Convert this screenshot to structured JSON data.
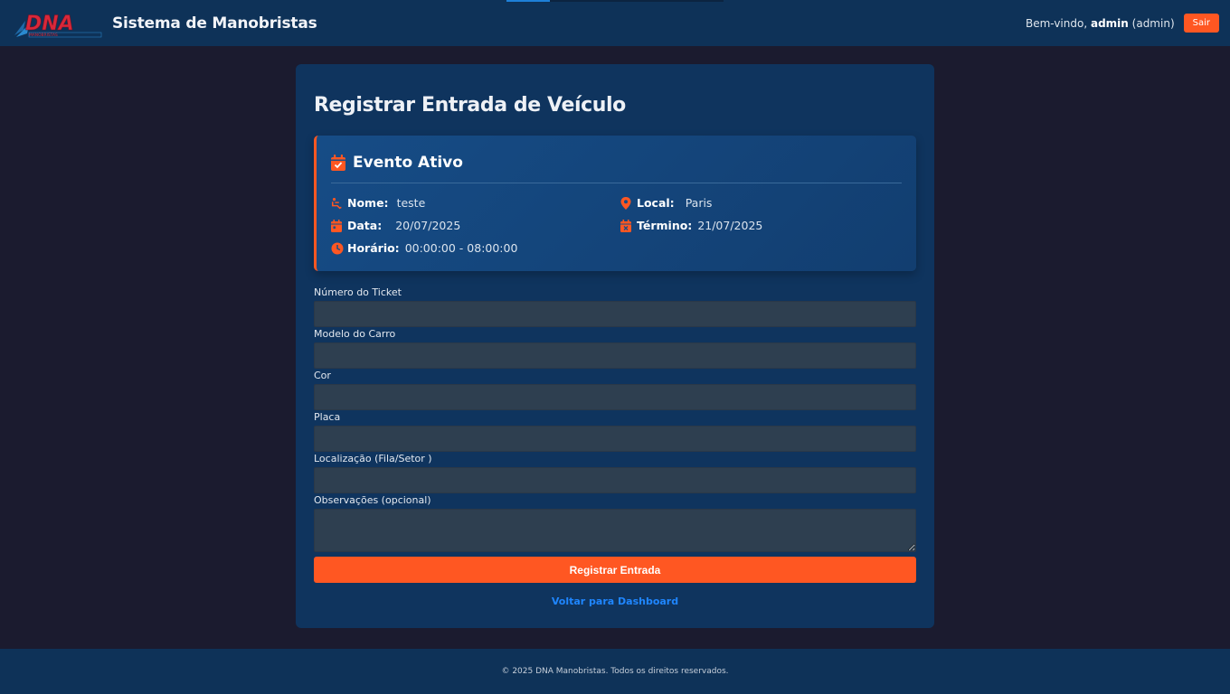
{
  "header": {
    "logo_text": "DNA",
    "logo_subtitle": "MANOBRISTAS",
    "title": "Sistema de Manobristas",
    "welcome_prefix": "Bem-vindo,",
    "username": "admin",
    "role": "(admin)",
    "logout_label": "Sair",
    "load_progress": 0.2
  },
  "page": {
    "title": "Registrar Entrada de Veículo"
  },
  "event": {
    "heading": "Evento Ativo",
    "name_label": "Nome:",
    "name_value": "teste",
    "location_label": "Local:",
    "location_value": "Paris",
    "date_label": "Data:",
    "date_value": "20/07/2025",
    "end_label": "Término:",
    "end_value": "21/07/2025",
    "time_label": "Horário:",
    "time_value": "00:00:00 - 08:00:00"
  },
  "form": {
    "ticket_label": "Número do Ticket",
    "ticket_value": "",
    "model_label": "Modelo do Carro",
    "model_value": "",
    "color_label": "Cor",
    "color_value": "",
    "plate_label": "Placa",
    "plate_value": "",
    "location_label": "Localização (Fila/Setor )",
    "location_value": "",
    "notes_label": "Observações (opcional)",
    "notes_value": "",
    "submit_label": "Registrar Entrada",
    "back_label": "Voltar para Dashboard"
  },
  "footer": {
    "text": "© 2025 DNA Manobristas. Todos os direitos reservados."
  },
  "colors": {
    "accent": "#ff5722",
    "header_bg": "#0e3258",
    "card_bg": "#0f345e",
    "page_bg": "#1b1b2f",
    "link": "#1f86ff"
  },
  "icons": [
    "calendar-check-icon",
    "person-wheelchair-icon",
    "map-pin-icon",
    "calendar-icon",
    "calendar-x-icon",
    "clock-icon"
  ]
}
